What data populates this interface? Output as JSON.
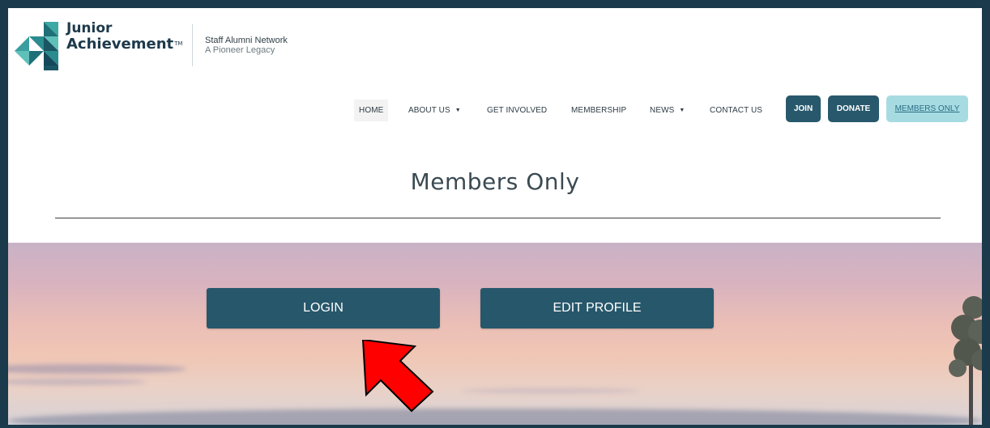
{
  "brand": {
    "name_line1": "Junior",
    "name_line2": "Achievement",
    "trademark": "TM",
    "tagline_line1": "Staff Alumni Network",
    "tagline_line2": "A Pioneer Legacy"
  },
  "nav": {
    "items": [
      {
        "label": "HOME"
      },
      {
        "label": "ABOUT US"
      },
      {
        "label": "GET INVOLVED"
      },
      {
        "label": "MEMBERSHIP"
      },
      {
        "label": "NEWS"
      },
      {
        "label": "CONTACT US"
      }
    ],
    "caret": "▼",
    "join_label": "JOIN",
    "donate_label": "DONATE",
    "members_only_label": "MEMBERS ONLY"
  },
  "page": {
    "title": "Members Only"
  },
  "hero": {
    "login_label": "LOGIN",
    "edit_profile_label": "EDIT PROFILE"
  },
  "colors": {
    "frame": "#1b3a4b",
    "brand_dark": "#28586c",
    "members_only_bg": "#a7dbe2",
    "annotation_arrow": "#ff0000"
  },
  "icons": {
    "logo": "junior-achievement-logo-icon",
    "annotation": "pointer-arrow-icon"
  }
}
